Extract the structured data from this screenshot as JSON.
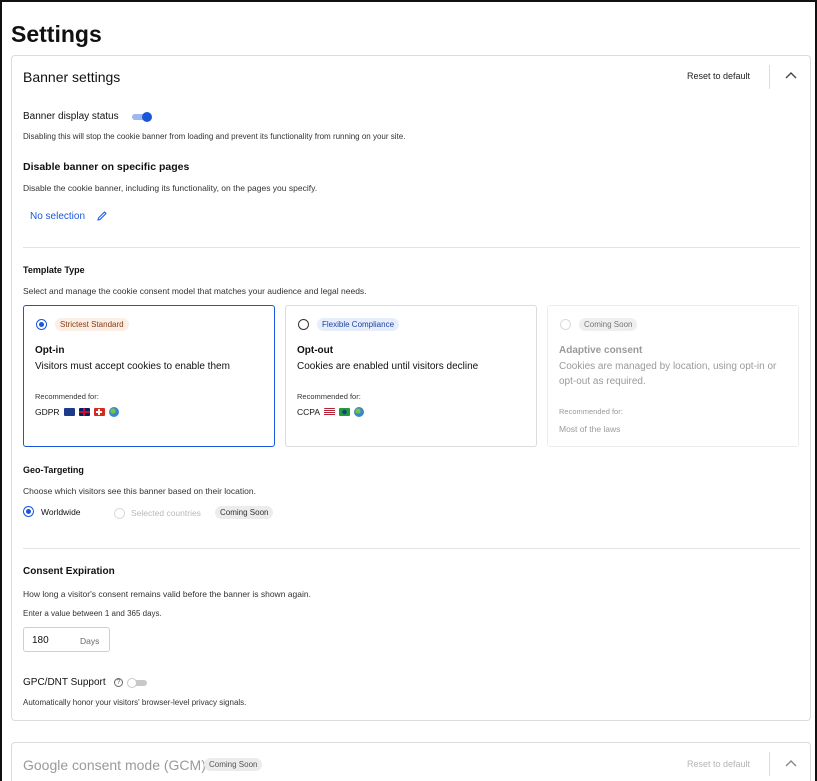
{
  "page": {
    "title": "Settings"
  },
  "banner_settings": {
    "title": "Banner settings",
    "reset_label": "Reset to default",
    "display_status": {
      "label": "Banner display status",
      "enabled": true,
      "description": "Disabling this will stop the cookie banner from loading and prevent its functionality from running on your site."
    },
    "disable_pages": {
      "label": "Disable banner on specific pages",
      "description": "Disable the cookie banner, including its functionality, on the pages you specify.",
      "selection_label": "No selection"
    },
    "template_type": {
      "label": "Template Type",
      "description": "Select and manage the cookie consent model that matches your audience and legal needs.",
      "options": [
        {
          "badge": "Strictest Standard",
          "title": "Opt-in",
          "description": "Visitors must accept cookies to enable them",
          "recommended_label": "Recommended for:",
          "laws": "GDPR",
          "selected": true
        },
        {
          "badge": "Flexible Compliance",
          "title": "Opt-out",
          "description": "Cookies are enabled until visitors decline",
          "recommended_label": "Recommended for:",
          "laws": "CCPA",
          "selected": false
        },
        {
          "badge": "Coming Soon",
          "title": "Adaptive consent",
          "description": "Cookies are managed by location, using opt-in or opt-out as required.",
          "recommended_label": "Recommended for:",
          "laws": "Most of the laws",
          "selected": false
        }
      ]
    },
    "geo_targeting": {
      "label": "Geo-Targeting",
      "description": "Choose which visitors see this banner based on their location.",
      "worldwide_label": "Worldwide",
      "selected_countries_label": "Selected countries",
      "coming_soon": "Coming Soon"
    },
    "consent_expiration": {
      "label": "Consent Expiration",
      "description": "How long a visitor's consent remains valid before the banner is shown again.",
      "hint": "Enter a value between 1 and 365 days.",
      "value": "180",
      "unit": "Days"
    },
    "gpc_dnt": {
      "label": "GPC/DNT Support",
      "enabled": false,
      "description": "Automatically honor your visitors' browser-level privacy signals."
    }
  },
  "gcm": {
    "title": "Google consent mode (GCM)",
    "badge": "Coming Soon",
    "reset_label": "Reset to default"
  },
  "colors": {
    "accent": "#1a56db",
    "orange_badge_bg": "#fbeee4",
    "blue_badge_bg": "#e6eefc"
  }
}
